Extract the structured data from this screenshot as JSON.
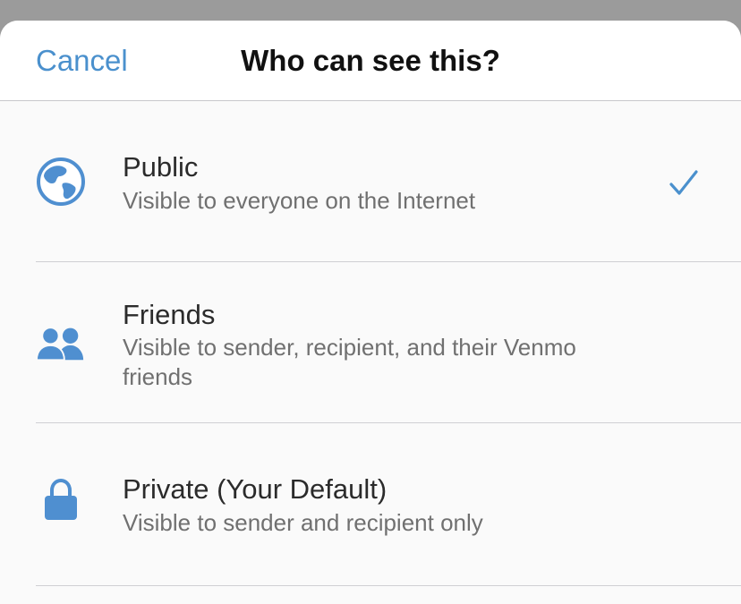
{
  "header": {
    "cancel_label": "Cancel",
    "title": "Who can see this?"
  },
  "options": [
    {
      "icon": "globe-icon",
      "label": "Public",
      "description": "Visible to everyone on the Internet",
      "selected": true
    },
    {
      "icon": "friends-icon",
      "label": "Friends",
      "description": "Visible to sender, recipient, and their Venmo friends",
      "selected": false
    },
    {
      "icon": "lock-icon",
      "label": "Private (Your Default)",
      "description": "Visible to sender and recipient only",
      "selected": false
    }
  ],
  "colors": {
    "accent": "#4a90cd",
    "icon": "#4f8fd0",
    "backdrop": "#9b9b9b"
  }
}
